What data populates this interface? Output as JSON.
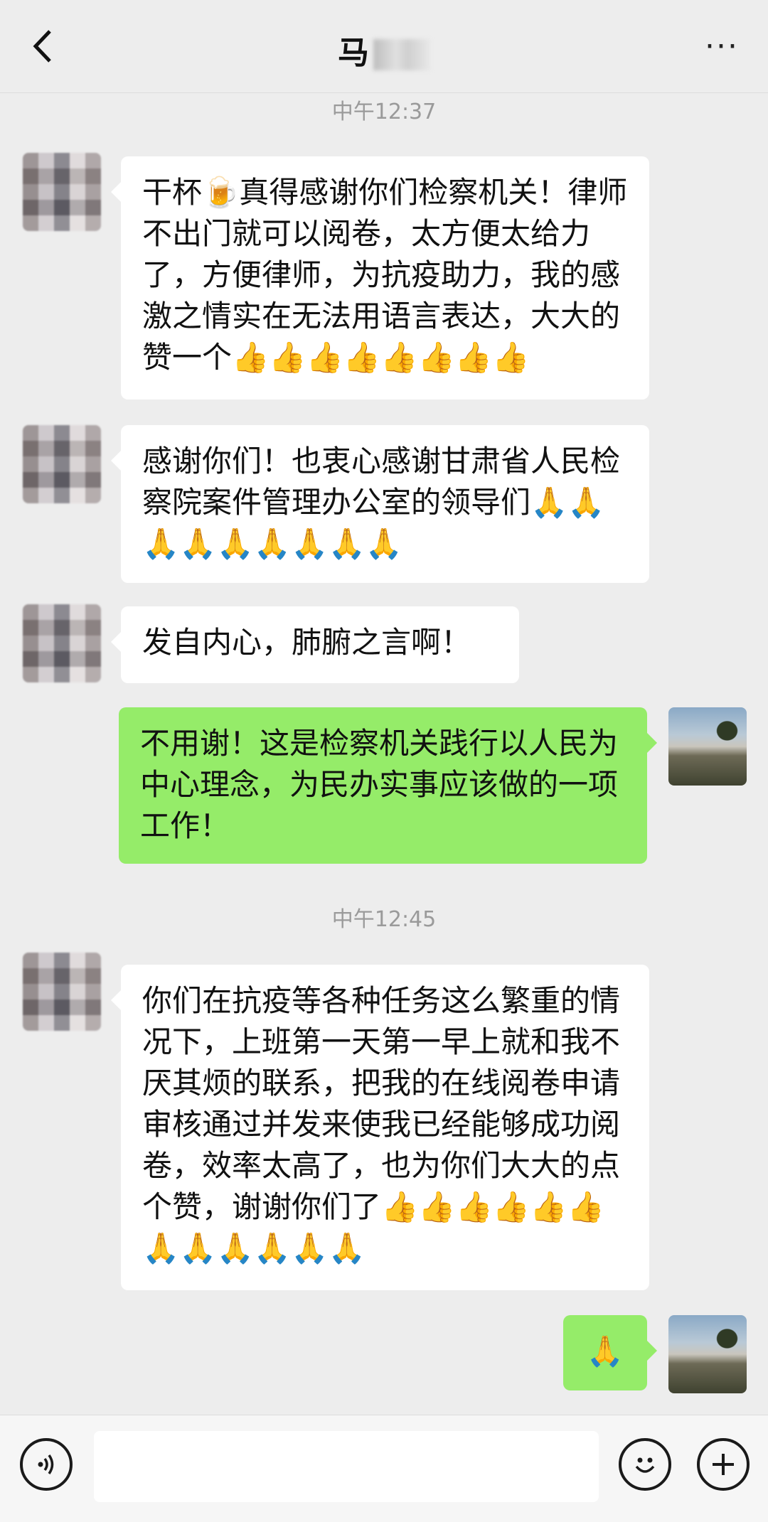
{
  "header": {
    "back_icon": "chevron-left-icon",
    "title": "马",
    "more_label": "···"
  },
  "messages": {
    "ts1": "中午12:37",
    "m1": "干杯🍺真得感谢你们检察机关！律师不出门就可以阅卷，太方便太给力了，方便律师，为抗疫助力，我的感激之情实在无法用语言表达，大大的赞一个👍👍👍👍👍👍👍👍",
    "m2": "感谢你们！也衷心感谢甘肃省人民检察院案件管理办公室的领导们🙏🙏🙏🙏🙏🙏🙏🙏🙏",
    "m3": "发自内心，肺腑之言啊！",
    "m4": "不用谢！这是检察机关践行以人民为中心理念，为民办实事应该做的一项工作！",
    "ts2": "中午12:45",
    "m5": "你们在抗疫等各种任务这么繁重的情况下，上班第一天第一早上就和我不厌其烦的联系，把我的在线阅卷申请审核通过并发来使我已经能够成功阅卷，效率太高了，也为你们大大的点个赞，谢谢你们了👍👍👍👍👍👍🙏🙏🙏🙏🙏🙏",
    "m6": "🙏"
  },
  "input_bar": {
    "voice_icon": "voice-icon",
    "input_value": "",
    "emoji_icon": "smiley-icon",
    "plus_icon": "plus-icon"
  },
  "colors": {
    "background": "#ededed",
    "bubble_them": "#ffffff",
    "bubble_me": "#95ec69",
    "timestamp": "#9a9a9a"
  }
}
